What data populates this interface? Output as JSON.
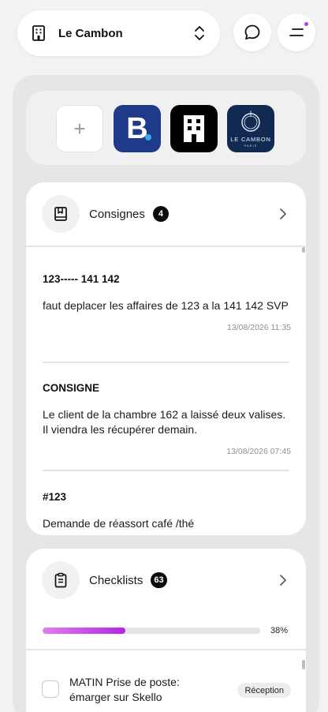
{
  "header": {
    "hotel_name": "Le Cambon",
    "accent_color": "#b93ce6"
  },
  "channels": {
    "add_label": "+",
    "booking_letter": "B.",
    "cambon_brand": "LE CAMBON",
    "cambon_city": "PARIS",
    "icons": [
      "plus-icon",
      "booking-logo",
      "hotel-building-logo",
      "le-cambon-logo"
    ]
  },
  "consignes": {
    "title": "Consignes",
    "count": "4",
    "items": [
      {
        "title": "123----- 141 142",
        "body": "faut deplacer les affaires de 123 a la 141 142 SVP",
        "time": "13/08/2026 11:35"
      },
      {
        "title": "CONSIGNE",
        "body": "Le client de la chambre 162 a laissé deux valises. Il viendra les récupérer demain.",
        "time": "13/08/2026 07:45"
      },
      {
        "title": "#123",
        "body": "Demande de réassort café /thé",
        "time": ""
      }
    ]
  },
  "checklists": {
    "title": "Checklists",
    "count": "63",
    "progress": 0.38,
    "progress_label": "38%",
    "tasks": [
      {
        "label": "MATIN Prise de poste: émarger sur Skello",
        "tag": "Réception",
        "checked": false
      }
    ]
  }
}
